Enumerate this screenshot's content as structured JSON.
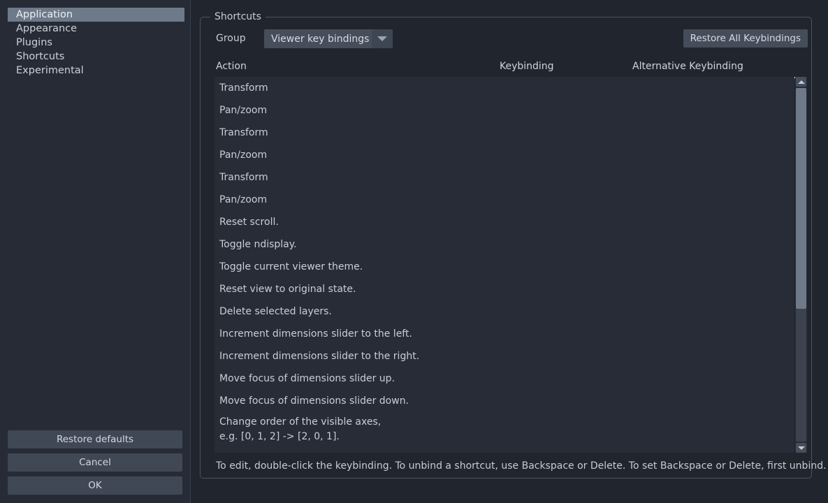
{
  "colors": {
    "window_bg": "#21252e",
    "sidebar_bg": "#262b35",
    "panel_bg": "#272c36",
    "accent_selection": "#6e7a8a",
    "button_bg": "#414855",
    "text": "#c8cdd5",
    "header_rule": "#f2f4f7"
  },
  "sidebar": {
    "items": [
      {
        "label": "Application",
        "selected": true
      },
      {
        "label": "Appearance",
        "selected": false
      },
      {
        "label": "Plugins",
        "selected": false
      },
      {
        "label": "Shortcuts",
        "selected": false
      },
      {
        "label": "Experimental",
        "selected": false
      }
    ],
    "buttons": [
      {
        "label": "Restore defaults",
        "name": "restore-defaults-button"
      },
      {
        "label": "Cancel",
        "name": "cancel-button"
      },
      {
        "label": "OK",
        "name": "ok-button"
      }
    ]
  },
  "main": {
    "groupbox_title": "Shortcuts",
    "group_field": {
      "label": "Group",
      "value": "Viewer key bindings",
      "arrow_icon": "chevron-down-icon"
    },
    "restore_all_label": "Restore All Keybindings",
    "table": {
      "columns": [
        "Action",
        "Keybinding",
        "Alternative Keybinding"
      ],
      "rows": [
        {
          "action": "Transform",
          "keybinding": "",
          "alternative": ""
        },
        {
          "action": "Pan/zoom",
          "keybinding": "",
          "alternative": ""
        },
        {
          "action": "Transform",
          "keybinding": "",
          "alternative": ""
        },
        {
          "action": "Pan/zoom",
          "keybinding": "",
          "alternative": ""
        },
        {
          "action": "Transform",
          "keybinding": "",
          "alternative": ""
        },
        {
          "action": "Pan/zoom",
          "keybinding": "",
          "alternative": ""
        },
        {
          "action": "Reset scroll.",
          "keybinding": "",
          "alternative": ""
        },
        {
          "action": "Toggle ndisplay.",
          "keybinding": "",
          "alternative": ""
        },
        {
          "action": "Toggle current viewer theme.",
          "keybinding": "",
          "alternative": ""
        },
        {
          "action": "Reset view to original state.",
          "keybinding": "",
          "alternative": ""
        },
        {
          "action": "Delete selected layers.",
          "keybinding": "",
          "alternative": ""
        },
        {
          "action": "Increment dimensions slider to the left.",
          "keybinding": "",
          "alternative": ""
        },
        {
          "action": "Increment dimensions slider to the right.",
          "keybinding": "",
          "alternative": ""
        },
        {
          "action": "Move focus of dimensions slider up.",
          "keybinding": "",
          "alternative": ""
        },
        {
          "action": "Move focus of dimensions slider down.",
          "keybinding": "",
          "alternative": ""
        },
        {
          "action": "Change order of the visible axes,\ne.g. [0, 1, 2] -> [2, 0, 1].",
          "keybinding": "",
          "alternative": ""
        }
      ]
    },
    "scrollbar": {
      "up_icon": "arrow-up-icon",
      "down_icon": "arrow-down-icon",
      "thumb_fraction_percent": 62.5
    },
    "hint": "To edit, double-click the keybinding. To unbind a shortcut, use Backspace or Delete. To set Backspace or Delete, first unbind."
  }
}
